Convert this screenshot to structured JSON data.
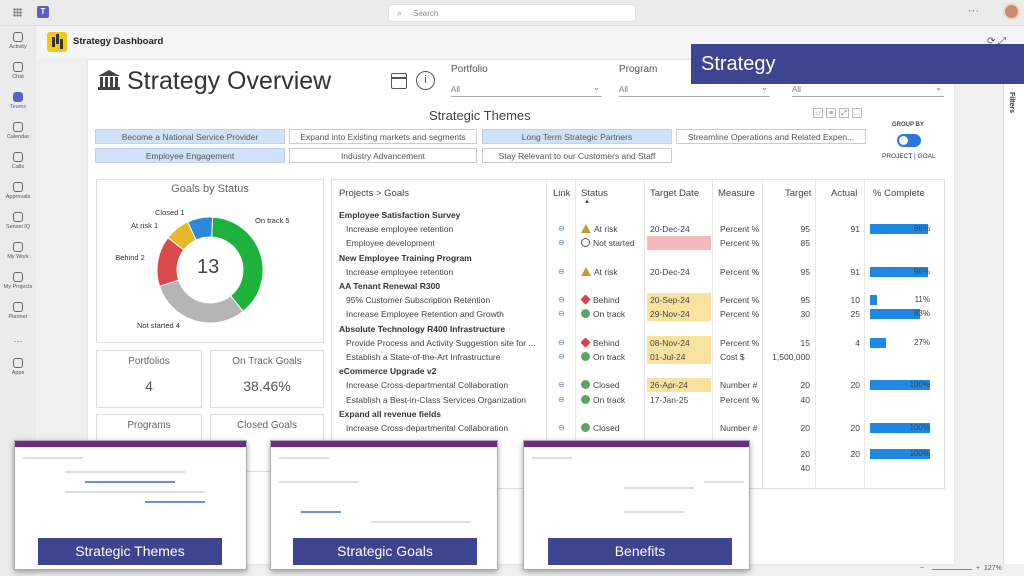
{
  "search": {
    "placeholder": "Search"
  },
  "rail": [
    {
      "label": "Activity"
    },
    {
      "label": "Chat"
    },
    {
      "label": "Teams"
    },
    {
      "label": "Calendar"
    },
    {
      "label": "Calls"
    },
    {
      "label": "Approvals"
    },
    {
      "label": "Sensei IQ"
    },
    {
      "label": "My Work"
    },
    {
      "label": "My Projects"
    },
    {
      "label": "Planner"
    },
    {
      "label": "Apps"
    }
  ],
  "app": {
    "title": "Strategy Dashboard"
  },
  "banner": {
    "strategy": "Strategy"
  },
  "page": {
    "title": "Strategy Overview"
  },
  "filters": {
    "pane_label": "Filters",
    "portfolio_label": "Portfolio",
    "portfolio_value": "All",
    "program_label": "Program",
    "program_value": "All",
    "third_value": "All"
  },
  "themes": {
    "title": "Strategic Themes",
    "items": [
      {
        "label": "Become a National Service Provider",
        "selected": true
      },
      {
        "label": "Expand into Existing markets and segments",
        "selected": false
      },
      {
        "label": "Long Term Strategic Partners",
        "selected": true
      },
      {
        "label": "Streamline Operations and Related Expen...",
        "selected": false
      },
      {
        "label": "Employee Engagement",
        "selected": true
      },
      {
        "label": "Industry Advancement",
        "selected": false
      },
      {
        "label": "Stay Relevant to our Customers and Staff",
        "selected": false
      }
    ],
    "group_by_label": "GROUP BY",
    "group_by_value": "PROJECT | GOAL"
  },
  "goals_by_status": {
    "title": "Goals by Status",
    "total": "13",
    "slices": [
      {
        "label": "On track 5",
        "value": 5,
        "color": "#1db23b"
      },
      {
        "label": "Not started 4",
        "value": 4,
        "color": "#b5b5b5"
      },
      {
        "label": "Behind 2",
        "value": 2,
        "color": "#db4a4a"
      },
      {
        "label": "At risk 1",
        "value": 1,
        "color": "#e5b826"
      },
      {
        "label": "Closed 1",
        "value": 1,
        "color": "#2b8ad8"
      }
    ]
  },
  "kpis": {
    "portfolios_label": "Portfolios",
    "portfolios_value": "4",
    "ontrack_label": "On Track Goals",
    "ontrack_value": "38.46%",
    "programs_label": "Programs",
    "closed_label": "Closed Goals"
  },
  "table": {
    "headers": [
      "Projects > Goals",
      "Link",
      "Status",
      "Target Date",
      "Measure",
      "Target",
      "Actual",
      "% Complete"
    ],
    "rows": [
      {
        "type": "group",
        "name": "Employee Satisfaction Survey"
      },
      {
        "type": "goal",
        "name": "Increase employee retention",
        "status": "At risk",
        "sicon": "risk",
        "date": "20-Dec-24",
        "dhl": "",
        "measure": "Percent %",
        "target": "95",
        "actual": "91",
        "pct": "96%",
        "pctv": 0.96
      },
      {
        "type": "goal",
        "name": "Employee development",
        "status": "Not started",
        "sicon": "notstarted",
        "date": "",
        "dhl": "red",
        "measure": "Percent %",
        "target": "85",
        "actual": "",
        "pct": "",
        "pctv": 0
      },
      {
        "type": "group",
        "name": "New Employee Training Program"
      },
      {
        "type": "goal",
        "name": "Increase employee retention",
        "status": "At risk",
        "sicon": "risk",
        "date": "20-Dec-24",
        "dhl": "",
        "measure": "Percent %",
        "target": "95",
        "actual": "91",
        "pct": "96%",
        "pctv": 0.96
      },
      {
        "type": "group",
        "name": "AA Tenant Renewal R300"
      },
      {
        "type": "goal",
        "name": "95% Customer Subscription Retention",
        "status": "Behind",
        "sicon": "behind",
        "date": "20-Sep-24",
        "dhl": "yel",
        "measure": "Percent %",
        "target": "95",
        "actual": "10",
        "pct": "11%",
        "pctv": 0.11
      },
      {
        "type": "goal",
        "name": "Increase Employee Retention and Growth",
        "status": "On track",
        "sicon": "ontrack",
        "date": "29-Nov-24",
        "dhl": "yel",
        "measure": "Percent %",
        "target": "30",
        "actual": "25",
        "pct": "83%",
        "pctv": 0.83
      },
      {
        "type": "group",
        "name": "Absolute Technology R400 Infrastructure"
      },
      {
        "type": "goal",
        "name": "Provide Process and Activity Suggestion site for ...",
        "status": "Behind",
        "sicon": "behind",
        "date": "08-Nov-24",
        "dhl": "yel",
        "measure": "Percent %",
        "target": "15",
        "actual": "4",
        "pct": "27%",
        "pctv": 0.27
      },
      {
        "type": "goal",
        "name": "Establish a State-of-the-Art Infrastructure",
        "status": "On track",
        "sicon": "ontrack",
        "date": "01-Jul-24",
        "dhl": "yel",
        "measure": "Cost $",
        "target": "1,500,000",
        "actual": "",
        "pct": "",
        "pctv": 0
      },
      {
        "type": "group",
        "name": "eCommerce Upgrade v2"
      },
      {
        "type": "goal",
        "name": "Increase Cross-departmental Collaboration",
        "status": "Closed",
        "sicon": "closed",
        "date": "26-Apr-24",
        "dhl": "yel",
        "measure": "Number #",
        "target": "20",
        "actual": "20",
        "pct": "100%",
        "pctv": 1
      },
      {
        "type": "goal",
        "name": "Establish a Best-in-Class Services Organization",
        "status": "On track",
        "sicon": "ontrack",
        "date": "17-Jan-25",
        "dhl": "",
        "measure": "Percent %",
        "target": "40",
        "actual": "",
        "pct": "",
        "pctv": 0
      },
      {
        "type": "group",
        "name": "Expand all revenue fields"
      },
      {
        "type": "goal",
        "name": "Increase Cross-departmental Collaboration",
        "status": "Closed",
        "sicon": "closed",
        "date": "",
        "dhl": "",
        "measure": "Number #",
        "target": "20",
        "actual": "20",
        "pct": "100%",
        "pctv": 1
      }
    ],
    "extra_rows": [
      {
        "target": "20",
        "actual": "20",
        "pct": "100%",
        "pctv": 1
      },
      {
        "target": "40",
        "actual": "",
        "pct": "",
        "pctv": 0
      }
    ]
  },
  "thumbnails": [
    {
      "label": "Strategic Themes"
    },
    {
      "label": "Strategic Goals"
    },
    {
      "label": "Benefits"
    }
  ],
  "statusbar": {
    "zoom": "127%"
  },
  "colors": {
    "accent": "#3e4590",
    "bar": "#1e88e5",
    "teams": "#5b5fc7"
  }
}
